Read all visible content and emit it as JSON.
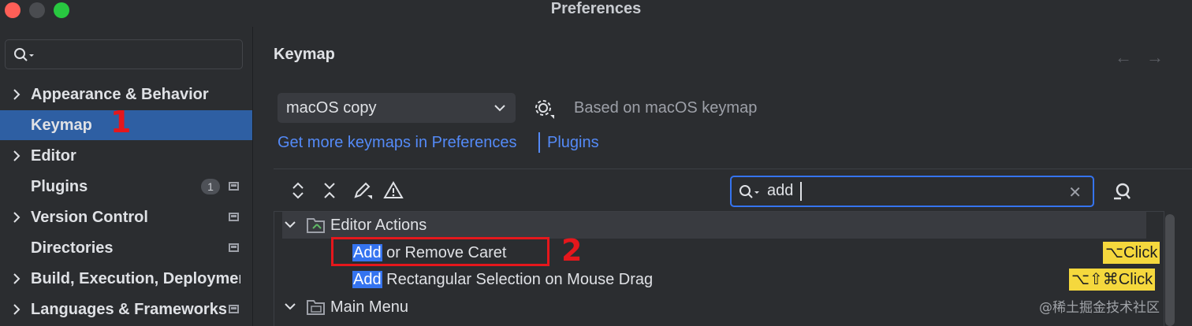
{
  "window": {
    "title": "Preferences"
  },
  "sidebar": {
    "search_placeholder": "",
    "items": [
      {
        "label": "Appearance & Behavior",
        "expandable": true
      },
      {
        "label": "Keymap",
        "selected": true
      },
      {
        "label": "Editor",
        "expandable": true
      },
      {
        "label": "Plugins",
        "badge": "1"
      },
      {
        "label": "Version Control",
        "expandable": true
      },
      {
        "label": "Directories"
      },
      {
        "label": "Build, Execution, Deployment",
        "expandable": true
      },
      {
        "label": "Languages & Frameworks",
        "expandable": true
      }
    ]
  },
  "annotations": {
    "first": "1",
    "second": "2",
    "color": "#e5171c"
  },
  "main": {
    "title": "Keymap",
    "keymap_select": {
      "value": "macOS copy"
    },
    "based_on": "Based on macOS keymap",
    "link_prefix": "Get more keymaps in Preferences",
    "link_plugins": "Plugins",
    "filter": {
      "value": "add"
    },
    "groups": [
      {
        "label": "Editor Actions",
        "actions": [
          {
            "match": "Add",
            "rest": " or Remove Caret",
            "shortcut": "⌥Click"
          },
          {
            "match": "Add",
            "rest": " Rectangular Selection on Mouse Drag",
            "shortcut": "⌥⇧⌘Click"
          }
        ]
      },
      {
        "label": "Main Menu"
      }
    ]
  },
  "watermark": "@稀土掘金技术社区",
  "colors": {
    "accent": "#3574f0",
    "selection": "#2e5fa3",
    "link": "#548af7",
    "shortcut_bg": "#f5d83d"
  }
}
